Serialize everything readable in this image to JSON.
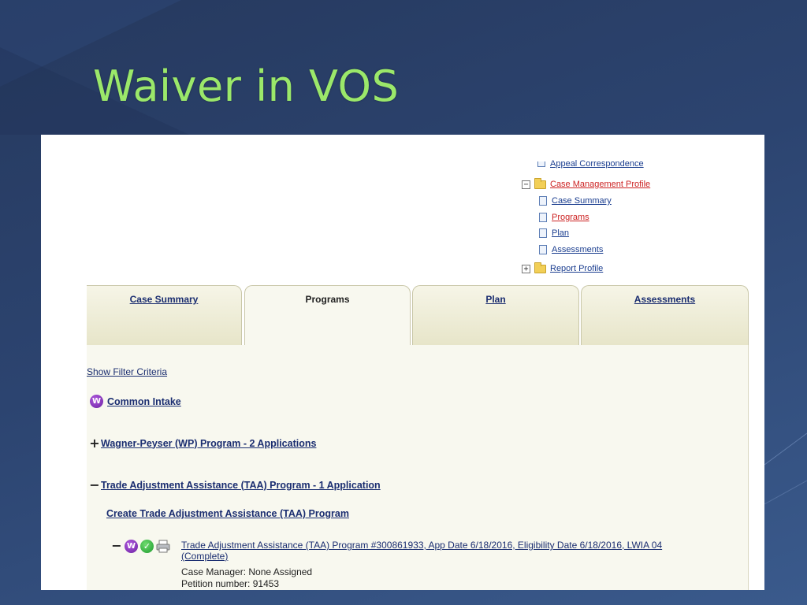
{
  "slide": {
    "title": "Waiver in VOS"
  },
  "tree": {
    "items": [
      {
        "label": "Appeal Correspondence",
        "icon": "document-icon",
        "active": false
      },
      {
        "label": "Case Management Profile",
        "icon": "folder-icon",
        "toggle": "−",
        "active": true
      },
      {
        "label": "Case Summary",
        "icon": "document-icon",
        "active": false
      },
      {
        "label": "Programs",
        "icon": "document-icon",
        "active": true
      },
      {
        "label": "Plan",
        "icon": "document-icon",
        "active": false
      },
      {
        "label": "Assessments",
        "icon": "document-icon",
        "active": false
      },
      {
        "label": "Report Profile",
        "icon": "folder-icon",
        "toggle": "+",
        "active": false
      }
    ]
  },
  "tabs": [
    {
      "label": "Case Summary",
      "selected": false
    },
    {
      "label": "Programs",
      "selected": true
    },
    {
      "label": "Plan",
      "selected": false
    },
    {
      "label": "Assessments",
      "selected": false
    }
  ],
  "content": {
    "filter_link": "Show Filter Criteria",
    "common_intake": {
      "label": "Common Intake",
      "badge": "W"
    },
    "wagner_peyser": {
      "toggle": "+",
      "label": "Wagner-Peyser (WP) Program - 2 Applications"
    },
    "taa_program": {
      "toggle": "−",
      "label": "Trade Adjustment Assistance (TAA) Program - 1 Application"
    },
    "create_taa": "Create Trade Adjustment Assistance (TAA) Program",
    "record": {
      "toggle": "−",
      "badge": "W",
      "check": "✓",
      "link_line1": "Trade Adjustment Assistance (TAA) Program #300861933, App Date 6/18/2016, Eligibility Date 6/18/2016, LWIA 04",
      "link_line2": "(Complete)",
      "case_manager": "Case Manager: None Assigned",
      "petition": "Petition number: 91453"
    }
  },
  "colors": {
    "title_green": "#9be86a",
    "link_blue": "#1a2d70",
    "active_red": "#cc2222",
    "tab_beige": "#e7e5c9",
    "panel_bg": "#f8f8ef"
  }
}
